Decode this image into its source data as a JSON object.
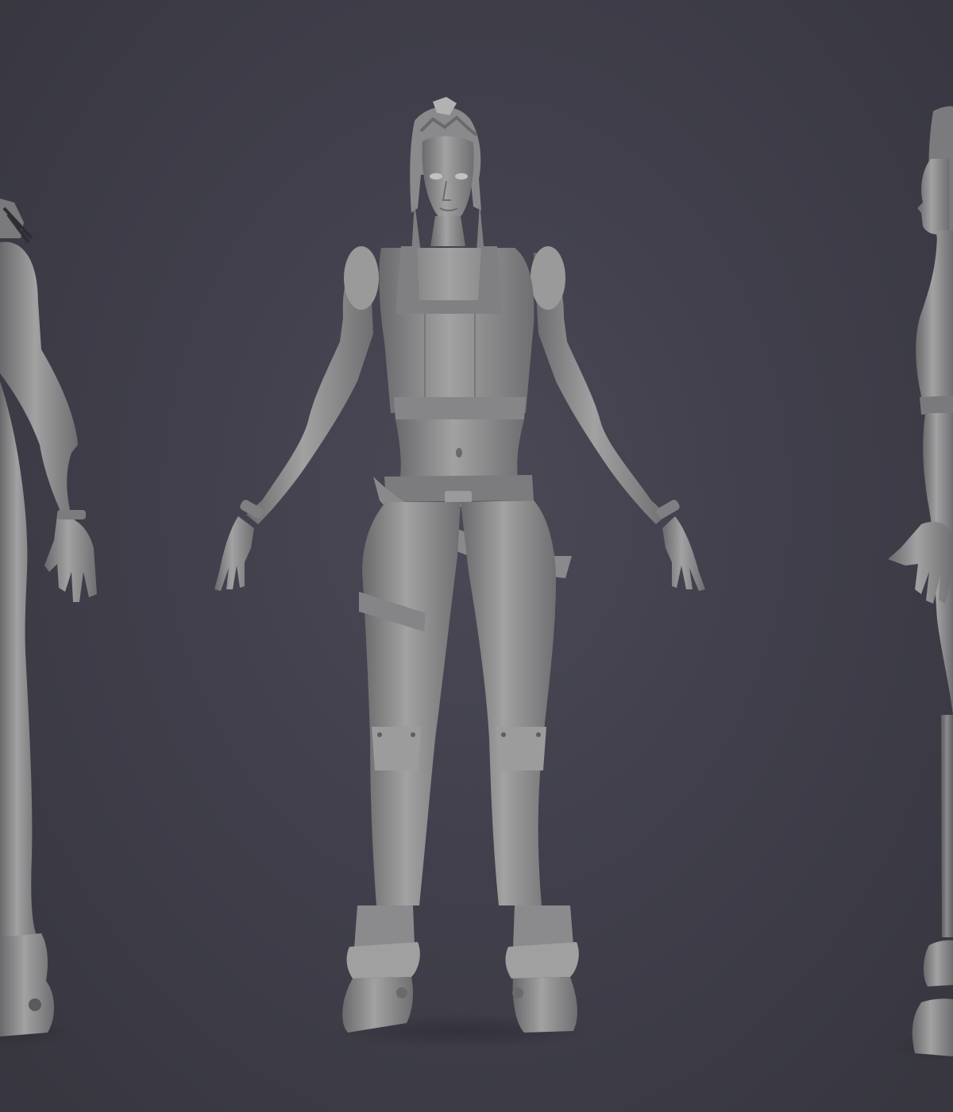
{
  "scene": {
    "background_color": "#403f4b",
    "model_color": "#8e8e8e",
    "views": [
      {
        "name": "back",
        "visibility": "partial-left"
      },
      {
        "name": "front",
        "visibility": "full-center"
      },
      {
        "name": "side",
        "visibility": "partial-right"
      }
    ]
  }
}
